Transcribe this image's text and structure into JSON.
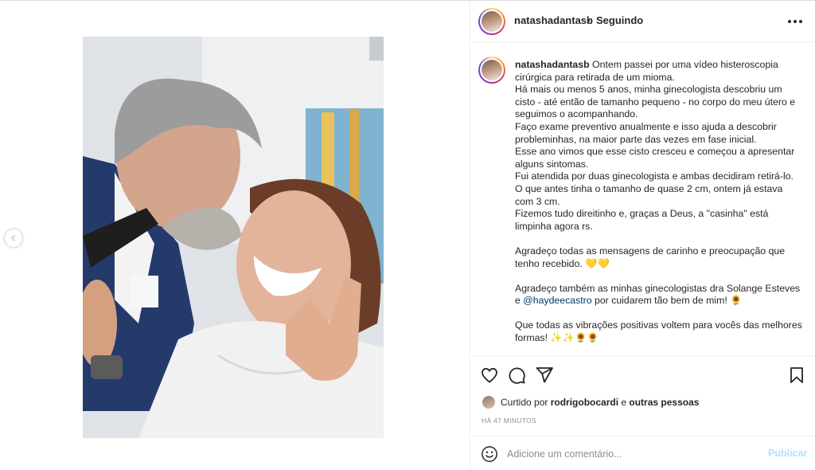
{
  "post": {
    "username": "natashadantasb",
    "separator": "•",
    "follow_status": "Seguindo"
  },
  "caption": {
    "username": "natashadantasb",
    "part1": " Ontem passei por uma vídeo histeroscopia cirúrgica para retirada de um mioma.\nHá mais ou menos 5 anos, minha ginecologista descobriu um cisto - até então de tamanho pequeno - no corpo do meu útero e seguimos o acompanhando.\nFaço exame preventivo anualmente e isso ajuda a descobrir probleminhas, na maior parte das vezes em fase inicial.\nEsse ano vimos que esse cisto cresceu e começou a apresentar alguns sintomas.\nFui atendida por duas ginecologista e ambas decidiram retirá-lo. O que antes tinha o tamanho de quase 2 cm, ontem já estava com 3 cm.\nFizemos tudo direitinho e, graças a Deus, a \"casinha\" está limpinha agora rs.\n\nAgradeço todas as mensagens de carinho e preocupação que tenho recebido. 💛💛\n\nAgradeço também as minhas ginecologistas dra Solange Esteves e ",
    "mention": "@haydeecastro",
    "part2": " por cuidarem tão bem de mim! 🌻\n\nQue todas as vibrações positivas voltem para vocês das melhores formas! ✨✨🌻🌻"
  },
  "likes": {
    "prefix": "Curtido por ",
    "user": "rodrigobocardi",
    "middle": " e ",
    "others": "outras pessoas"
  },
  "time_ago": "HÁ 47 MINUTOS",
  "comment": {
    "placeholder": "Adicione um comentário...",
    "publish_label": "Publicar"
  },
  "icons": {
    "like": "heart-icon",
    "comment": "comment-icon",
    "share": "share-icon",
    "save": "bookmark-icon",
    "more": "more-options-icon",
    "emoji": "emoji-icon",
    "prev": "chevron-left-icon"
  },
  "colors": {
    "mention": "#00376b",
    "publish_disabled": "#b2dffc",
    "muted": "#8e8e8e",
    "text": "#262626"
  }
}
